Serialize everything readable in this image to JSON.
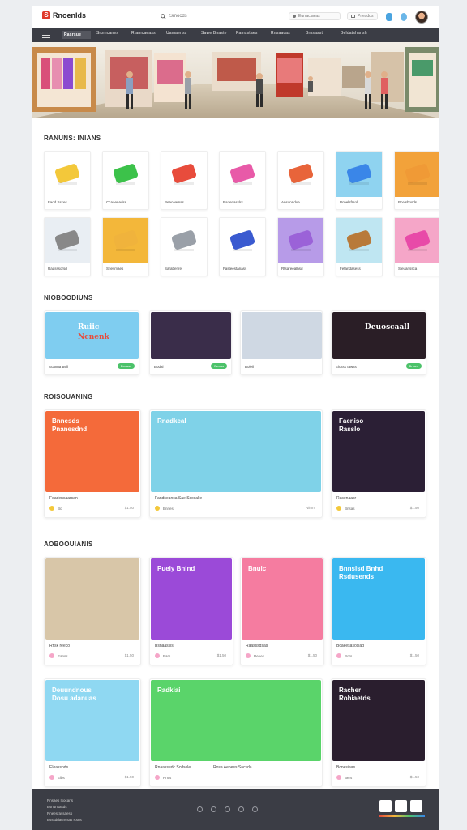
{
  "header": {
    "logo_mark": "S",
    "logo_text": "Rnoenlds",
    "search_placeholder": "Smocds",
    "input_a": "Eurraclaeas",
    "input_b": "Pnesdds",
    "icon_names": [
      "search-icon",
      "bell-icon",
      "globe-icon",
      "avatar"
    ]
  },
  "nav": {
    "items": [
      "Rasrsue",
      "Sromcanes",
      "Rtamcaeass",
      "Uamaenss",
      "Sawe Bnaste",
      "Pamsstaes",
      "Rnsaacas",
      "Brnsasst",
      "Beldatshansh"
    ]
  },
  "sections": {
    "categories_title": "RANUNS: INIANS",
    "featured_title": "NIOBOODIUNS",
    "promotions_title": "ROISOUANING",
    "recommended_title": "AOBOOUIANIS"
  },
  "categories": [
    {
      "label": "Fadd Ssces",
      "color": "#f3c83a"
    },
    {
      "label": "Ccaaenadss",
      "color": "#3cc24a"
    },
    {
      "label": "Beacoarnss",
      "color": "#e84c3c"
    },
    {
      "label": "Rsoenasslrs",
      "color": "#e85aa8"
    },
    {
      "label": "Ansonndue",
      "color": "#e8643a"
    },
    {
      "label": "Pcnelsfrsol",
      "color": "#3a86e8"
    },
    {
      "label": "Pcelsbosds",
      "color": "#f09a36"
    },
    {
      "label": "Raasssorsd",
      "color": "#888888"
    },
    {
      "label": "Sriesmaes",
      "color": "#f0b33c"
    },
    {
      "label": "Sarabenre",
      "color": "#9aa0a8"
    },
    {
      "label": "Fasteestanass",
      "color": "#3a5ad0"
    },
    {
      "label": "Rtsareealhsd",
      "color": "#9b62d8"
    },
    {
      "label": "Fefandasess",
      "color": "#b87a3a"
    },
    {
      "label": "Sleuanssca",
      "color": "#e84aa8"
    }
  ],
  "featured": [
    {
      "label": "Scanna Bell",
      "overlay_top": "Ruiic",
      "overlay_bottom": "Ncnenk",
      "pill": "Ecoass"
    },
    {
      "label": "Bodal",
      "pill": "Bwnss"
    },
    {
      "label": "Boleil",
      "pill": ""
    },
    {
      "label": "Elcssk Iawss",
      "overlay_top": "Deuoscaall",
      "pill": "Bnaes"
    }
  ],
  "promotions": [
    {
      "label": "Feadensaarcan",
      "overlay_top": "Bnnesds",
      "overlay_bottom": "Pnanesdnd",
      "meta": "Bc",
      "price": "$1.50"
    },
    {
      "label": "Fandseanca Sae Scocalle",
      "overlay_top": "Rnadkeal",
      "meta": "Bnnes",
      "price": "Nimm"
    },
    {
      "label": "Rasenaasr",
      "overlay_top": "Faeniso",
      "overlay_bottom": "Rasslo",
      "meta": "Bnsas",
      "price": "$1.50"
    }
  ],
  "recommended": [
    {
      "label": "Rfisk reeco",
      "meta": "Eanss",
      "price": "$1.50"
    },
    {
      "label": "Bsnaassls",
      "overlay_top": "Pueiy Bnind",
      "meta": "Bars",
      "price": "$1.50"
    },
    {
      "label": "Raasssdsas",
      "overlay_top": "Bnuic",
      "meta": "Reues",
      "price": "$1.50"
    },
    {
      "label": "Bcaeesasoslad",
      "overlay_top": "Bnnslsd Bnhd",
      "overlay_bottom": "Rsdusends",
      "meta": "Bors",
      "price": "$1.50"
    },
    {
      "label": "Eloassnds",
      "overlay_top": "Deuundnous",
      "overlay_bottom": "Dosu adanuas",
      "meta": "Elbs",
      "price": "$1.50"
    },
    {
      "label": "Rnaassedc Scdsele",
      "overlay_top": "Radkiai",
      "label2": "Rosa Aeness Sacsda",
      "meta": "Rncs",
      "price": ""
    },
    {
      "label": "Bcnesiaas",
      "overlay_top": "Racher",
      "overlay_bottom": "Rohiaetds",
      "meta": "Bers",
      "price": "$1.50"
    }
  ],
  "footer": {
    "lines": [
      "Rnsaes Ixocans",
      "Bsnunsasds",
      "Rneesrassaeso",
      "Bsssddacnssas Rsns"
    ]
  },
  "colors": {
    "nav_bg": "#3b3d45",
    "accent_green": "#4cc26a",
    "accent_red": "#e0392b"
  }
}
